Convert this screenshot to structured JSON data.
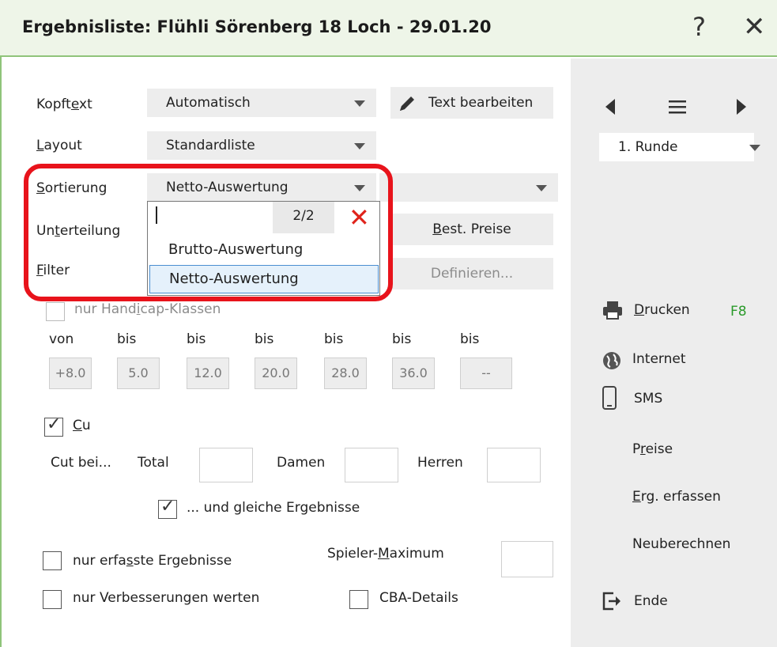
{
  "window": {
    "title": "Ergebnisliste: Flühli Sörenberg 18 Loch - 29.01.20",
    "help_label": "?",
    "close_label": "✕"
  },
  "form": {
    "kopftext": {
      "pre": "Kopft",
      "u": "e",
      "post": "xt",
      "value": "Automatisch"
    },
    "text_button": "Text bearbeiten",
    "layout": {
      "u": "L",
      "post": "ayout",
      "value": "Standardliste"
    },
    "sortierung": {
      "u": "S",
      "post": "ortierung",
      "value": "Netto-Auswertung"
    },
    "unterteilung": {
      "pre": "Un",
      "u": "t",
      "post": "erteilung"
    },
    "filter": {
      "u": "F",
      "post": "ilter"
    },
    "best_preise": {
      "u": "B",
      "post": "est. Preise"
    },
    "definieren": "Definieren...",
    "handicap": {
      "pre": "nur Hand",
      "u": "i",
      "post": "cap-Klassen"
    },
    "ranges": {
      "headers": [
        "von",
        "bis",
        "bis",
        "bis",
        "bis",
        "bis",
        "bis"
      ],
      "values": [
        "+8.0",
        "5.0",
        "12.0",
        "20.0",
        "28.0",
        "36.0",
        "--"
      ]
    },
    "cut": {
      "label_u": "C",
      "label_post": "u"
    },
    "cut_bei": "Cut bei...",
    "total": "Total",
    "damen": "Damen",
    "herren": "Herren",
    "gleiche": "... und gleiche Ergebnisse",
    "erfasste": {
      "pre": "nur erfa",
      "u": "s",
      "post": "ste Ergebnisse"
    },
    "spieler_max": {
      "pre": "Spieler-",
      "u": "M",
      "post": "aximum"
    },
    "verbesserungen": "nur Verbesserungen werten",
    "cba": "CBA-Details"
  },
  "dropdown": {
    "count": "2/2",
    "items": [
      "Brutto-Auswertung",
      "Netto-Auswertung"
    ],
    "selected": "Netto-Auswertung"
  },
  "right_panel": {
    "runde": "1. Runde",
    "drucken": {
      "u": "D",
      "post": "rucken"
    },
    "drucken_key": "F8",
    "internet": "Internet",
    "sms": "SMS",
    "preise": {
      "pre": "P",
      "u": "r",
      "post": "eise"
    },
    "erg": {
      "u": "E",
      "post": "rg. erfassen"
    },
    "neuberechnen": "Neuberechnen",
    "ende": "Ende"
  },
  "colors": {
    "accent_green": "#8fc47a",
    "highlight_red": "#e8131b",
    "close_red": "#e0231b"
  }
}
